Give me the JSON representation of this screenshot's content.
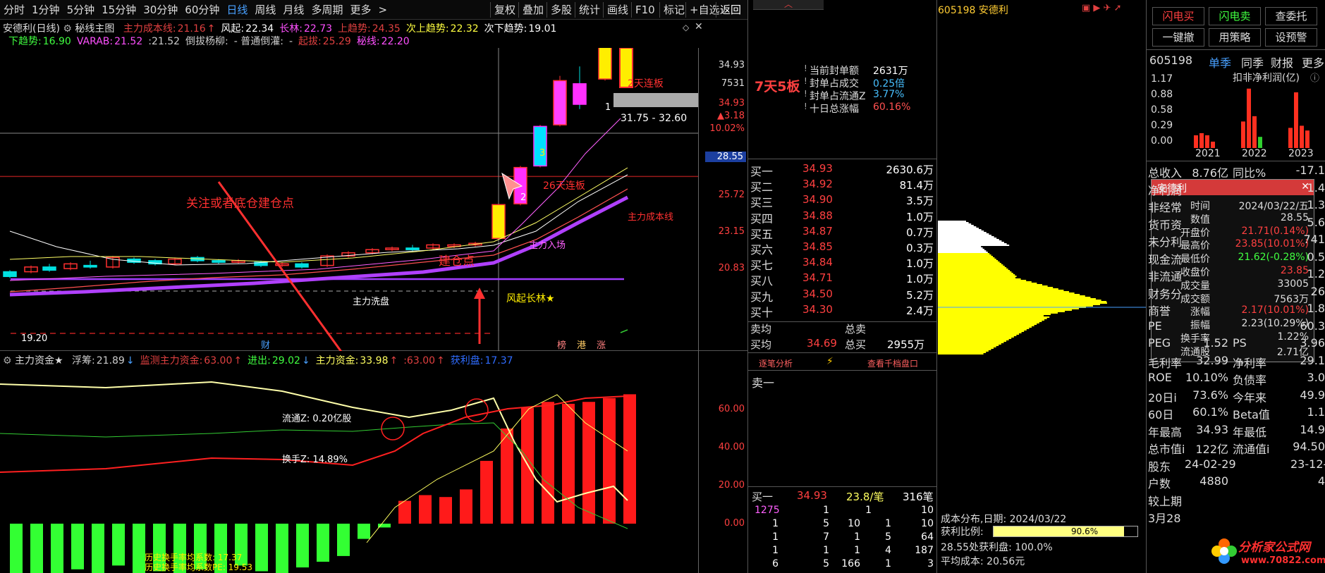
{
  "toolbar": {
    "left": [
      "分时",
      "1分钟",
      "5分钟",
      "15分钟",
      "30分钟",
      "60分钟",
      "日线",
      "周线",
      "月线",
      "多周期",
      "更多"
    ],
    "right": [
      "复权",
      "叠加",
      "多股",
      "统计",
      "画线",
      "F10",
      "标记",
      "+自选",
      "返回"
    ]
  },
  "main": {
    "title": "安德利(日线)",
    "indicator_name": "秘线主图",
    "line1": [
      {
        "t": "主力成本线:",
        "c": "#e04040"
      },
      {
        "t": "21.16",
        "c": "#e04040"
      },
      {
        "t": "↑",
        "c": "#e04040"
      },
      {
        "t": "风起:",
        "c": "#fff"
      },
      {
        "t": "22.34",
        "c": "#fff"
      },
      {
        "t": "长林:",
        "c": "#ff50ff"
      },
      {
        "t": "22.73",
        "c": "#ff50ff"
      },
      {
        "t": "上趋势:",
        "c": "#e04040"
      },
      {
        "t": "24.35",
        "c": "#e04040"
      },
      {
        "t": "次上趋势:",
        "c": "#ffff40"
      },
      {
        "t": "22.32",
        "c": "#ffff40"
      },
      {
        "t": "次下趋势:",
        "c": "#fff"
      },
      {
        "t": "19.01",
        "c": "#fff"
      }
    ],
    "line2": [
      {
        "t": "下趋势:",
        "c": "#40ff40"
      },
      {
        "t": "16.90",
        "c": "#40ff40"
      },
      {
        "t": "VARAB:",
        "c": "#ff50ff"
      },
      {
        "t": "21.52",
        "c": "#ff50ff"
      },
      {
        "t": ":21.52",
        "c": "#ccc"
      },
      {
        "t": "倒拔杨柳:",
        "c": "#ccc"
      },
      {
        "t": "- 普通倒灌:",
        "c": "#ccc"
      },
      {
        "t": "-",
        "c": "#ccc"
      },
      {
        "t": "起拔:",
        "c": "#e04040"
      },
      {
        "t": "25.29",
        "c": "#e04040"
      },
      {
        "t": "秘线:",
        "c": "#ff50ff"
      },
      {
        "t": "22.20",
        "c": "#ff50ff"
      }
    ],
    "y_labels": [
      "34.93",
      "7531",
      "34.93",
      "▲3.18",
      "10.02%",
      "28.55",
      "25.72",
      "23.15",
      "20.83"
    ],
    "crosshair_price": "28.55",
    "annotations": {
      "focus": "关注或者底仓建仓点",
      "build": "建仓点",
      "limit_top": "2天连板",
      "limit_26": "26天连板",
      "range": "31.75 - 32.60",
      "cost_line": "主力成本线",
      "main_enter": "主力入场",
      "main_wash": "主力洗盘",
      "wind": "风起长林★",
      "low": "19.20",
      "num1": "1",
      "num2": "2",
      "num3": "3",
      "fin": "财",
      "tags": [
        "榜",
        "港",
        "涨"
      ]
    }
  },
  "sub": {
    "title": "主力资金★",
    "line": [
      {
        "t": "浮筹:",
        "c": "#ccc"
      },
      {
        "t": "21.89",
        "c": "#ccc"
      },
      {
        "t": "↓",
        "c": "#48a0ff"
      },
      {
        "t": "监测主力资金:",
        "c": "#e04040"
      },
      {
        "t": "63.00",
        "c": "#e04040"
      },
      {
        "t": "↑",
        "c": "#e04040"
      },
      {
        "t": "进出:",
        "c": "#40ff40"
      },
      {
        "t": "29.02",
        "c": "#40ff40"
      },
      {
        "t": "↓",
        "c": "#48a0ff"
      },
      {
        "t": "主力资金:",
        "c": "#ffff60"
      },
      {
        "t": "33.98",
        "c": "#ffff60"
      },
      {
        "t": "↑",
        "c": "#e04040"
      },
      {
        "t": ":63.00",
        "c": "#e04040"
      },
      {
        "t": "↑",
        "c": "#e04040"
      },
      {
        "t": "获利盘:",
        "c": "#2f6cff"
      },
      {
        "t": "17.37",
        "c": "#2f6cff"
      }
    ],
    "y_labels": [
      "60.00",
      "40.00",
      "20.00",
      "0.00"
    ],
    "float_label": "流通Z: 0.20亿股",
    "turn_label": "换手Z: 14.89%",
    "hist1": "历史换手率均系数:  17.37",
    "hist2": "历史换手率均系数PE: 19.53",
    "bars": [
      -30,
      -28,
      -26,
      -24,
      -30,
      -22,
      -27,
      -25,
      -28,
      -24,
      -26,
      -22,
      -25,
      -27,
      -23,
      -20,
      -17,
      -8,
      -2,
      12,
      15,
      14,
      18,
      33,
      50,
      61,
      64,
      63,
      64,
      66,
      68
    ]
  },
  "orderbook": {
    "stats": [
      {
        "label": "当前封单额",
        "value": "2631万",
        "vc": "#ffffff"
      },
      {
        "label": "封单占成交",
        "value": "0.25倍",
        "vc": "#48c0ff"
      },
      {
        "label": "封单占流通Z",
        "value": "3.77%",
        "vc": "#48c0ff"
      },
      {
        "label": "十日总涨幅",
        "value": "60.16%",
        "vc": "#ff5050"
      }
    ],
    "badge": "7天5板",
    "bids": [
      {
        "n": "买一",
        "p": "34.93",
        "v": "2630.6万"
      },
      {
        "n": "买二",
        "p": "34.92",
        "v": "81.4万"
      },
      {
        "n": "买三",
        "p": "34.90",
        "v": "3.5万"
      },
      {
        "n": "买四",
        "p": "34.88",
        "v": "1.0万"
      },
      {
        "n": "买五",
        "p": "34.87",
        "v": "0.7万"
      },
      {
        "n": "买六",
        "p": "34.85",
        "v": "0.3万"
      },
      {
        "n": "买七",
        "p": "34.84",
        "v": "1.0万"
      },
      {
        "n": "买八",
        "p": "34.71",
        "v": "1.0万"
      },
      {
        "n": "买九",
        "p": "34.50",
        "v": "5.2万"
      },
      {
        "n": "买十",
        "p": "34.30",
        "v": "2.4万"
      }
    ],
    "sell_avg": "卖均",
    "sell_total": "总卖",
    "buy_avg": "买均",
    "buy_avg_price": "34.69",
    "buy_total": "总买",
    "buy_total_v": "2955万",
    "tabs": [
      "逐笔分析",
      "⚡",
      "查看千档盘口"
    ],
    "sell1": "卖一",
    "buy1": {
      "n": "买一",
      "p": "34.93",
      "v": "23.8/笔",
      "c": "316笔"
    },
    "detail": [
      [
        "1275",
        "1",
        "1",
        "10"
      ],
      [
        "1",
        "5",
        "10",
        "1",
        "10"
      ],
      [
        "1",
        "7",
        "1",
        "5",
        "64"
      ],
      [
        "1",
        "1",
        "1",
        "4",
        "187"
      ],
      [
        "6",
        "5",
        "166",
        "1",
        "3"
      ]
    ]
  },
  "chips": {
    "code_name": "605198 安德利",
    "date_line": "成本分布,日期: 2024/03/22",
    "profit_label": "获利比例:",
    "profit_value": "90.6%",
    "profit_pct": 90.6,
    "line2": "28.55处获利盘: 100.0%",
    "line3": "平均成本: 20.56元"
  },
  "right": {
    "buttons": [
      [
        "闪电买",
        "闪电卖",
        "查委托"
      ],
      [
        "一键撤",
        "用策略",
        "设预警"
      ]
    ],
    "code": "605198",
    "tabs": [
      "单季",
      "同季",
      "财报",
      "更多"
    ],
    "chart_title": "扣非净利润(亿)",
    "y": [
      "1.17",
      "0.88",
      "0.58",
      "0.29",
      "0.00"
    ],
    "years": [
      "2021",
      "2022",
      "2023"
    ],
    "rows": [
      {
        "l": "总收入",
        "v": "8.76亿",
        "l2": "同比%",
        "v2": "-17.1"
      },
      {
        "l": "净利润",
        "v": "",
        "l2": "",
        "v2": "1.4"
      },
      {
        "l": "非经常",
        "v": "",
        "l2": "",
        "v2": "1.3"
      },
      {
        "l": "货币资",
        "v": "",
        "l2": "",
        "v2": "5.6"
      },
      {
        "l": "未分利",
        "v": "",
        "l2": "",
        "v2": "741"
      },
      {
        "l": "现金流",
        "v": "",
        "l2": "",
        "v2": "0.5"
      },
      {
        "l": "非流通",
        "v": "",
        "l2": "",
        "v2": "1.2"
      },
      {
        "l": "财务分",
        "v": "",
        "l2": "",
        "v2": "26"
      },
      {
        "l": "商誉",
        "v": "",
        "l2": "",
        "v2": "1.8"
      },
      {
        "l": "PE",
        "v": "",
        "l2": "",
        "v2": "60.3"
      },
      {
        "l": "PEG",
        "v": "1.52",
        "l2": "PS",
        "v2": "3.96"
      },
      {
        "l": "毛利率",
        "v": "32.99",
        "l2": "净利率",
        "v2": "29.1"
      },
      {
        "l": "ROE",
        "v": "10.10%",
        "l2": "负债率",
        "v2": "3.0"
      },
      {
        "l": "20日i",
        "v": "73.6%",
        "l2": "今年来",
        "v2": "49.9"
      },
      {
        "l": "60日",
        "v": "60.1%",
        "l2": "Beta值",
        "v2": "1.1"
      },
      {
        "l": "年最高",
        "v": "34.93",
        "l2": "年最低",
        "v2": "14.9"
      },
      {
        "l": "总市值i",
        "v": "122亿",
        "l2": "流通值i",
        "v2": "94.50"
      },
      {
        "l": "股东",
        "v": "24-02-29",
        "l2": "",
        "v2": "23-12-"
      },
      {
        "l": "户数",
        "v": "4880",
        "l2": "",
        "v2": "4"
      },
      {
        "l": "较上期",
        "v": "",
        "l2": "",
        "v2": ""
      },
      {
        "l": "3月28",
        "v": "",
        "l2": "",
        "v2": ""
      }
    ],
    "watermark1": "分析家公式网",
    "watermark2": "www.70822.com"
  },
  "popup": {
    "title": "安德利",
    "close": "✕",
    "rows": [
      {
        "l": "时间",
        "v": "2024/03/22/五",
        "c": "#ddd"
      },
      {
        "l": "数值",
        "v": "28.55",
        "c": "#ddd"
      },
      {
        "l": "开盘价",
        "v": "21.71(0.14%)",
        "c": "#ff4040"
      },
      {
        "l": "最高价",
        "v": "23.85(10.01%)",
        "c": "#ff4040"
      },
      {
        "l": "最低价",
        "v": "21.62(-0.28%)",
        "c": "#40ff40"
      },
      {
        "l": "收盘价",
        "v": "23.85",
        "c": "#ff4040"
      },
      {
        "l": "成交量",
        "v": "33005",
        "c": "#ddd"
      },
      {
        "l": "成交额",
        "v": "7563万",
        "c": "#ddd"
      },
      {
        "l": "涨幅",
        "v": "2.17(10.01%)",
        "c": "#ff4040"
      },
      {
        "l": "振幅",
        "v": "2.23(10.29%)",
        "c": "#ddd"
      },
      {
        "l": "换手率",
        "v": "1.22%",
        "c": "#ddd"
      },
      {
        "l": "流通股",
        "v": "2.71亿",
        "c": "#ddd"
      }
    ]
  },
  "colors": {
    "up": "#ff3030",
    "down": "#00e0e0",
    "bar_up": "#ff1a1a",
    "bar_down": "#33ff33",
    "accent": "#48a0ff"
  }
}
